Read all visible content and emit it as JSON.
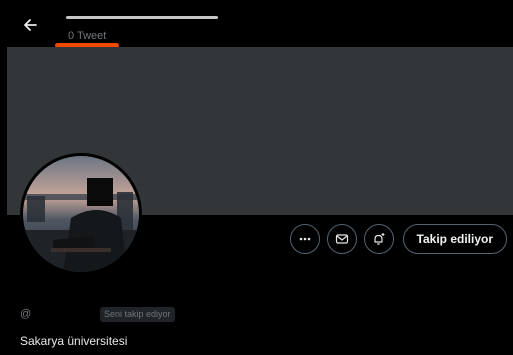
{
  "header": {
    "back_icon": "arrow-left-icon",
    "tweet_count": "0 Tweet"
  },
  "profile": {
    "handle_prefix": "@",
    "follows_you_badge": "Seni takip ediyor",
    "bio": "Sakarya üniversitesi"
  },
  "actions": {
    "more_icon": "more-dots-icon",
    "message_icon": "envelope-icon",
    "notify_icon": "bell-plus-icon",
    "follow_label": "Takip ediliyor"
  },
  "colors": {
    "background": "#000000",
    "banner": "#333639",
    "annotation": "#f04a00",
    "muted_text": "#71767b",
    "border": "#536471"
  }
}
